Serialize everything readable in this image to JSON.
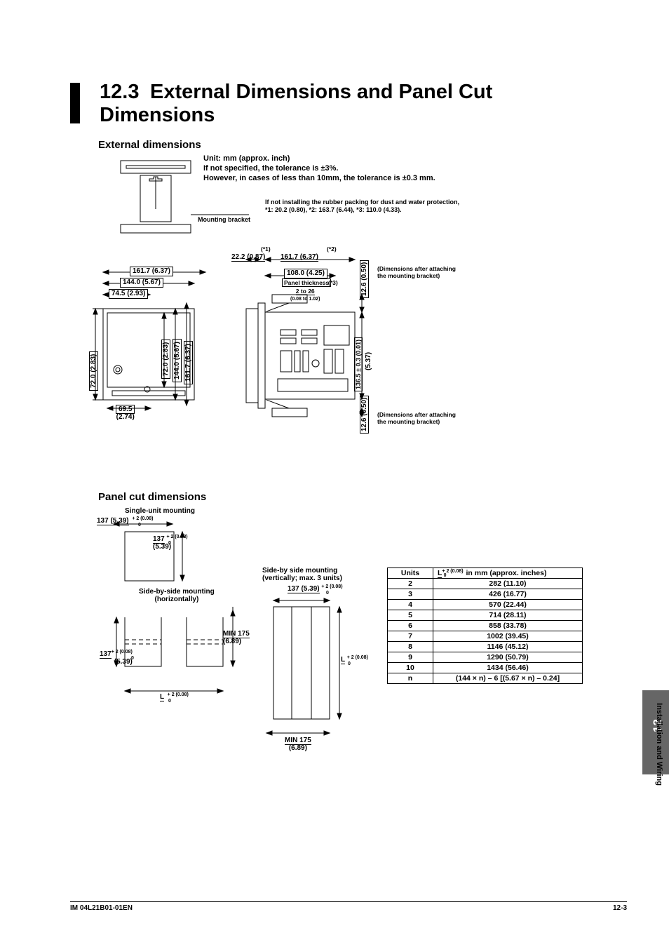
{
  "title_num": "12.3",
  "title_text": "External Dimensions and Panel Cut Dimensions",
  "section1": "External dimensions",
  "notes1_l1": "Unit: mm (approx. inch)",
  "notes1_l2": "If not specified, the tolerance is ±3%.",
  "notes1_l3": "However, in cases of less than 10mm, the tolerance is ±0.3 mm.",
  "notes2_l1": "If not installing the rubber packing for dust and water protection,",
  "notes2_l2": "*1: 20.2 (0.80), *2: 163.7 (6.44), *3: 110.0 (4.33).",
  "mounting_bracket": "Mounting bracket",
  "dim_161_7": "161.7 (6.37)",
  "dim_144_0": "144.0 (5.67)",
  "dim_74_5": "74.5 (2.93)",
  "dim_v_72_0": "72.0 (2.83)",
  "dim_v_72_0b": "72.0 (2.83)",
  "dim_v_144_0": "144.0 (5.67)",
  "dim_v_161_7": "161.7 (6.37)",
  "dim_69_5": "69.5",
  "dim_69_5b": "(2.74)",
  "star1": "(*1)",
  "dim_22_2": "22.2 (0.87)",
  "star2": "(*2)",
  "dim_r_161_7": "161.7 (6.37)",
  "dim_108_0": "108.0 (4.25)",
  "panel_thick": "Panel thickness",
  "star3": "(*3)",
  "thick_range": "2 to 26",
  "thick_range2": "(0.08 to 1.02)",
  "dim_v_12_6": "12.6 (0.50)",
  "bracket_note1": "(Dimensions after attaching",
  "bracket_note2": "the mounting bracket)",
  "dim_v_136_5": "136.5 ± 0.3 (0.01)",
  "dim_v_5_37": "(5.37)",
  "dim_v_12_6b": "12.6 (0.50)",
  "bracket_note3": "(Dimensions after attaching",
  "bracket_note4": "the mounting bracket)",
  "section2": "Panel cut dimensions",
  "single_unit": "Single-unit mounting",
  "dim_137_h": "137 (5.39)",
  "tol_208": "+ 2 (0.08)",
  "tol_0": "0",
  "dim_137_v": "137",
  "dim_137_vb": "(5.39)",
  "sbs_h": "Side-by-side mounting",
  "sbs_h2": "(horizontally)",
  "min_175": "MIN 175",
  "min_175b": "(6.89)",
  "dim_L": "L",
  "dim_137L": "137",
  "dim_137Lb": "(5.39)",
  "sbs_v1": "Side-by side mounting",
  "sbs_v2": "(vertically; max. 3 units)",
  "dim_137_top": "137 (5.39)",
  "dim_Lv": "L",
  "min_175v": "MIN 175",
  "min_175vb": "(6.89)",
  "table_h1": "Units",
  "table_h2a": "L",
  "table_h2b": "in mm (approx. inches)",
  "r2u": "2",
  "r2v": "282 (11.10)",
  "r3u": "3",
  "r3v": "426 (16.77)",
  "r4u": "4",
  "r4v": "570 (22.44)",
  "r5u": "5",
  "r5v": "714 (28.11)",
  "r6u": "6",
  "r6v": "858 (33.78)",
  "r7u": "7",
  "r7v": "1002 (39.45)",
  "r8u": "8",
  "r8v": "1146 (45.12)",
  "r9u": "9",
  "r9v": "1290 (50.79)",
  "r10u": "10",
  "r10v": "1434 (56.46)",
  "rnu": "n",
  "rnv": "(144 × n) – 6 [(5.67 × n) – 0.24]",
  "tab_num": "12",
  "side": "Installation and Wiring",
  "footer_l": "IM 04L21B01-01EN",
  "footer_r": "12-3"
}
